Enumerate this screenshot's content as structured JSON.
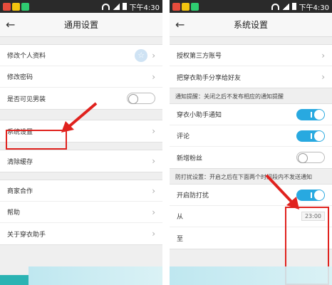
{
  "status": {
    "time": "下午4:30"
  },
  "left": {
    "title": "通用设置",
    "back_icon": "←",
    "groups": [
      [
        {
          "label": "修改个人资料",
          "right": "avatar"
        },
        {
          "label": "修改密码",
          "right": "chev"
        },
        {
          "label": "是否可见男装",
          "right": "toggle-off"
        }
      ],
      [
        {
          "label": "系统设置",
          "right": "chev"
        }
      ],
      [
        {
          "label": "清除缓存",
          "right": "chev"
        }
      ],
      [
        {
          "label": "商家合作",
          "right": "chev"
        },
        {
          "label": "帮助",
          "right": "chev"
        },
        {
          "label": "关于穿衣助手",
          "right": "chev"
        }
      ]
    ]
  },
  "right": {
    "title": "系统设置",
    "back_icon": "←",
    "top_items": [
      "授权第三方账号",
      "把穿衣助手分享给好友"
    ],
    "notify_label": "通知提醒：关闭之后不发布相应的通知提醒",
    "notify_items": [
      {
        "label": "穿衣小助手通知",
        "state": "on"
      },
      {
        "label": "评论",
        "state": "on"
      },
      {
        "label": "新增粉丝",
        "state": "off"
      }
    ],
    "dnd_label": "防打扰设置：开启之后在下面两个时间段内不发送通知",
    "dnd_toggle_label": "开启防打扰",
    "from_label": "从",
    "from_value": "23:00",
    "to_label": "至"
  },
  "colors": {
    "accent": "#28a9e0",
    "highlight": "#e0221e"
  }
}
